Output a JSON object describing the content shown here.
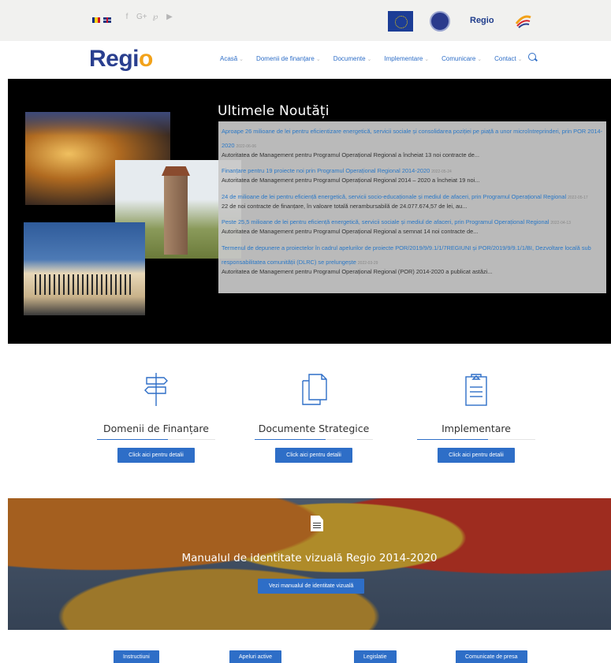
{
  "topbar": {
    "languages": [
      "ro",
      "en"
    ],
    "social_icons": [
      "facebook-icon",
      "google-plus-icon",
      "pinterest-icon",
      "youtube-icon"
    ],
    "social_glyphs": [
      "f",
      "G+",
      "℘",
      "▶"
    ],
    "partner_logo_text": "Regio"
  },
  "navbar": {
    "brand_main": "Regi",
    "brand_accent": "o",
    "items": [
      {
        "label": "Acasă"
      },
      {
        "label": "Domenii de finanțare"
      },
      {
        "label": "Documente"
      },
      {
        "label": "Implementare"
      },
      {
        "label": "Comunicare"
      },
      {
        "label": "Contact"
      }
    ]
  },
  "news": {
    "title": "Ultimele Noutăți",
    "items": [
      {
        "link": "Aproape 26 milioane de lei pentru eficientizare energetică, servicii sociale și consolidarea poziției pe piață a unor microîntreprinderi, prin POR 2014-2020",
        "date": "2022-06-06",
        "excerpt": "Autoritatea de Management pentru Programul Operațional Regional a încheiat 13 noi contracte de..."
      },
      {
        "link": "Finanțare pentru 19 proiecte noi prin Programul Operațional Regional 2014-2020",
        "date": "2022-05-24",
        "excerpt": "Autoritatea de Management pentru Programul Operațional Regional 2014 – 2020 a încheiat 19 noi..."
      },
      {
        "link": "24 de milioane de lei pentru eficiență energetică, servicii socio-educaționale și mediul de afaceri, prin Programul Operațional Regional",
        "date": "2022-05-17",
        "excerpt": "22 de noi contracte de finanțare, în valoare totală nerambursabilă de 24.077.674,57 de lei, au..."
      },
      {
        "link": "Peste 25,5 milioane de lei pentru eficiență energetică, servicii sociale și mediul de afaceri, prin Programul Operațional Regional",
        "date": "2022-04-13",
        "excerpt": "Autoritatea de Management pentru Programul Operațional Regional a semnat 14 noi contracte de..."
      },
      {
        "link": "Termenul de depunere a proiectelor în cadrul apelurilor de proiecte POR/2019/9/9.1/1/7REGIUNI și POR/2019/9/9.1/1/BI, Dezvoltare locală sub responsabilitatea comunității (DLRC) se prelungește",
        "date": "2022-03-29",
        "excerpt": "Autoritatea de Management pentru Programul Operațional Regional (POR) 2014-2020 a publicat astăzi..."
      }
    ]
  },
  "features": [
    {
      "title": "Domenii de Finanțare",
      "button": "Click aici pentru detalii",
      "icon": "signpost-icon"
    },
    {
      "title": "Documente Strategice",
      "button": "Click aici pentru detalii",
      "icon": "documents-icon"
    },
    {
      "title": "Implementare",
      "button": "Click aici pentru detalii",
      "icon": "clipboard-icon"
    }
  ],
  "banner": {
    "title": "Manualul de identitate vizuală Regio 2014-2020",
    "button": "Vezi manualul de identitate vizuală"
  },
  "quick_links": [
    "Instructiuni",
    "Apeluri active",
    "Legislatie",
    "Comunicate de presa"
  ],
  "colors": {
    "accent": "#2e6ec7",
    "brand": "#2a3f8f",
    "brand_accent": "#f2a21a"
  }
}
